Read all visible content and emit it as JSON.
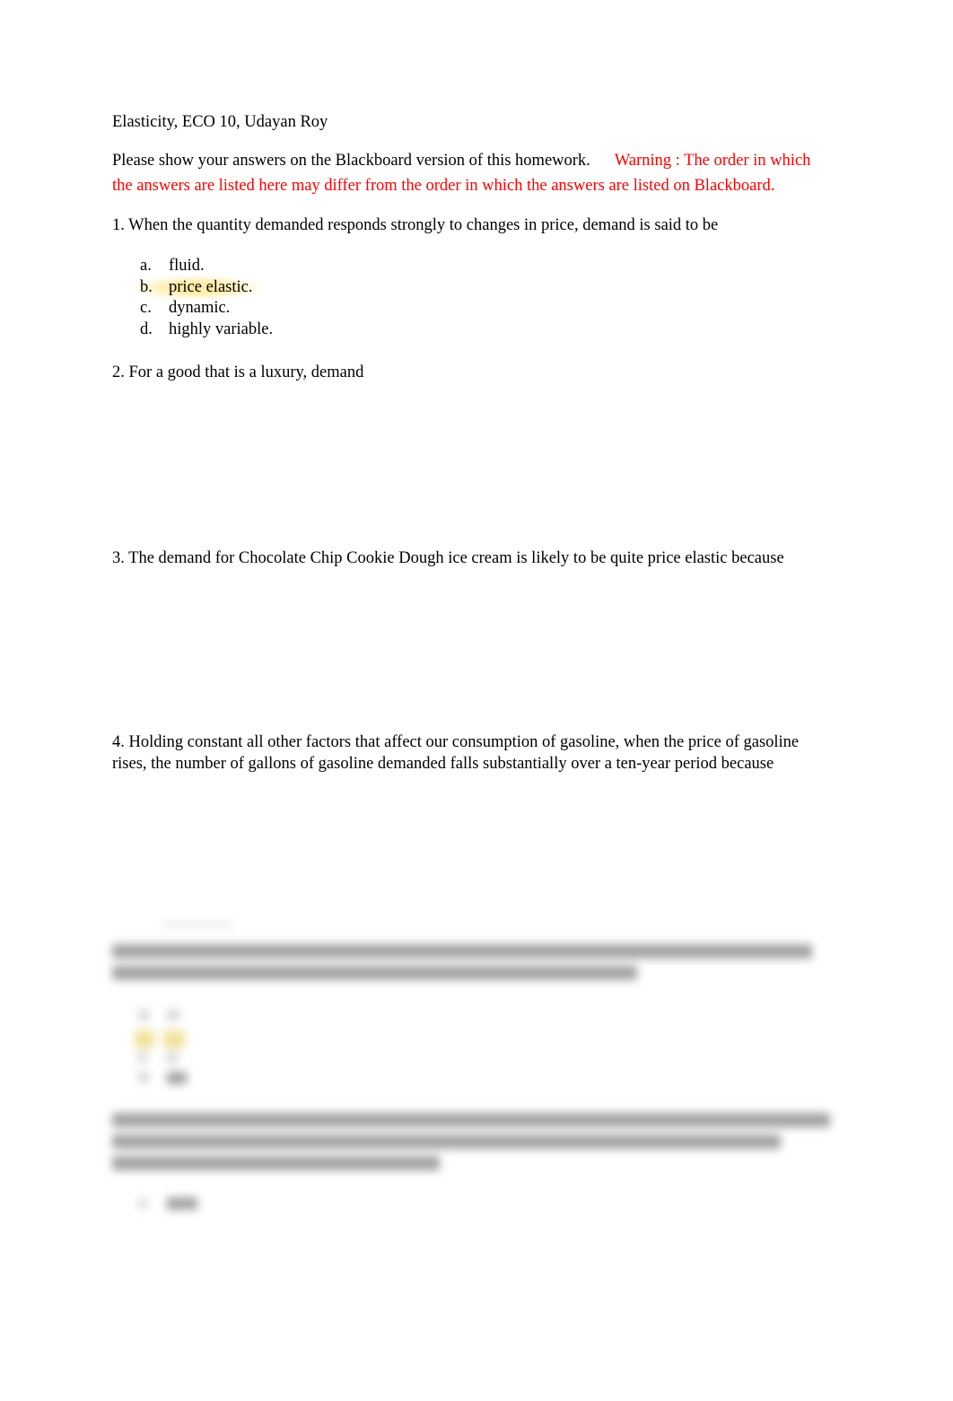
{
  "document": {
    "title": "Elasticity, ECO 10, Udayan Roy",
    "instructions": {
      "text": "Please show your answers on the Blackboard version of this homework.",
      "warning_line1": "Warning : The order in which",
      "warning_line2": "the answers are listed here may differ from the order in which the answers are listed on Blackboard."
    },
    "accent_color": "#ff0000",
    "highlight_color": "#fde68a",
    "questions": [
      {
        "text": "1. When the quantity demanded responds strongly to changes in price, demand is said to be",
        "options": [
          {
            "letter": "a.",
            "text": "fluid.",
            "highlighted": false
          },
          {
            "letter": "b.",
            "text": "price elastic.",
            "highlighted": true
          },
          {
            "letter": "c.",
            "text": "dynamic.",
            "highlighted": false
          },
          {
            "letter": "d.",
            "text": "highly variable.",
            "highlighted": false
          }
        ]
      },
      {
        "text": "2. For a good that is a luxury, demand"
      },
      {
        "text": "3. The demand for Chocolate Chip Cookie Dough ice cream is likely to be quite price elastic because"
      },
      {
        "text_line1": "4. Holding constant all other factors that affect our consumption of gasoline, when the price of gasoline",
        "text_line2": "rises, the number of gallons of gasoline demanded falls substantially over a ten-year period because"
      }
    ],
    "blurred_section": {
      "visible": false,
      "note": "remaining questions obscured"
    }
  }
}
